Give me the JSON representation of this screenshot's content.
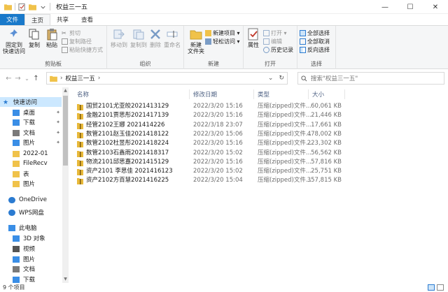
{
  "window": {
    "title": "权益三一五",
    "controls": {
      "minimize": "—",
      "maximize": "☐",
      "close": "✕"
    }
  },
  "ribbon_tabs": [
    "文件",
    "主页",
    "共享",
    "查看"
  ],
  "ribbon": {
    "clipboard": {
      "label": "剪贴板",
      "pin": "固定到\n快速访问",
      "copy": "复制",
      "paste": "粘贴",
      "cut": "剪切",
      "copy_path": "复制路径",
      "paste_shortcut": "粘贴快捷方式"
    },
    "organize": {
      "label": "组织",
      "move_to": "移动到",
      "copy_to": "复制到",
      "delete": "删除",
      "rename": "重命名"
    },
    "new": {
      "label": "新建",
      "new_folder": "新建\n文件夹",
      "new_item": "新建项目 ▾",
      "easy_access": "轻松访问 ▾"
    },
    "open": {
      "label": "打开",
      "properties": "属性",
      "open": "打开 ▾",
      "edit": "编辑",
      "history": "历史记录"
    },
    "select": {
      "label": "选择",
      "select_all": "全部选择",
      "select_none": "全部取消",
      "invert": "反向选择"
    }
  },
  "navigation": {
    "back": "←",
    "forward": "→",
    "recent": "⌄",
    "up": "↑",
    "breadcrumb": "权益三一五",
    "breadcrumb_sep": "›",
    "dropdown": "⌄",
    "refresh": "↻",
    "search_placeholder": "搜索\"权益三一五\""
  },
  "nav_pane": [
    {
      "label": "快速访问",
      "icon": "star-icon",
      "color": "#2b7bd1",
      "pinned": false,
      "selected": true
    },
    {
      "label": "桌面",
      "icon": "desktop-icon",
      "color": "#3a8ee6",
      "pinned": true,
      "selected": false
    },
    {
      "label": "下载",
      "icon": "download-icon",
      "color": "#3a8ee6",
      "pinned": true,
      "selected": false
    },
    {
      "label": "文档",
      "icon": "document-icon",
      "color": "#7a7a7a",
      "pinned": true,
      "selected": false
    },
    {
      "label": "图片",
      "icon": "pictures-icon",
      "color": "#3a8ee6",
      "pinned": true,
      "selected": false
    },
    {
      "label": "2022-01",
      "icon": "folder-icon",
      "color": "#f0c24a",
      "pinned": false,
      "selected": false
    },
    {
      "label": "FileRecv",
      "icon": "folder-icon",
      "color": "#f0c24a",
      "pinned": false,
      "selected": false
    },
    {
      "label": "表",
      "icon": "folder-icon",
      "color": "#f0c24a",
      "pinned": false,
      "selected": false
    },
    {
      "label": "图片",
      "icon": "folder-icon",
      "color": "#f0c24a",
      "pinned": false,
      "selected": false
    },
    {
      "label": "OneDrive",
      "icon": "cloud-icon",
      "color": "#2b7bd1",
      "pinned": false,
      "selected": false
    },
    {
      "label": "WPS网盘",
      "icon": "cloud-drive-icon",
      "color": "#2b7bd1",
      "pinned": false,
      "selected": false
    },
    {
      "label": "此电脑",
      "icon": "computer-icon",
      "color": "#3a8ee6",
      "pinned": false,
      "selected": false
    },
    {
      "label": "3D 对象",
      "icon": "3d-objects-icon",
      "color": "#3a8ee6",
      "pinned": false,
      "selected": false
    },
    {
      "label": "视频",
      "icon": "video-icon",
      "color": "#555555",
      "pinned": false,
      "selected": false
    },
    {
      "label": "图片",
      "icon": "pictures-icon",
      "color": "#3a8ee6",
      "pinned": false,
      "selected": false
    },
    {
      "label": "文档",
      "icon": "document-icon",
      "color": "#7a7a7a",
      "pinned": false,
      "selected": false
    },
    {
      "label": "下载",
      "icon": "download-icon",
      "color": "#3a8ee6",
      "pinned": false,
      "selected": false
    }
  ],
  "pin_glyph": "✦",
  "columns": {
    "name": "名称",
    "date": "修改日期",
    "type": "类型",
    "size": "大小"
  },
  "files": [
    {
      "name": "国贸2101尤亚皎2021413129",
      "date": "2022/3/20 15:16",
      "type": "压缩(zipped)文件...",
      "size": "60,061 KB"
    },
    {
      "name": "金融2101贾思彤2021417139",
      "date": "2022/3/20 15:16",
      "type": "压缩(zipped)文件...",
      "size": "21,446 KB"
    },
    {
      "name": "经管2102王娜 2021414226",
      "date": "2022/3/18 23:07",
      "type": "压缩(zipped)文件...",
      "size": "17,661 KB"
    },
    {
      "name": "数管2101赵玉佳2021418122",
      "date": "2022/3/20 15:06",
      "type": "压缩(zipped)文件...",
      "size": "478,002 KB"
    },
    {
      "name": "数管2102杜昱彤2021418224",
      "date": "2022/3/20 15:16",
      "type": "压缩(zipped)文件...",
      "size": "223,302 KB"
    },
    {
      "name": "数管2103石鑫雨2021418317",
      "date": "2022/3/20 15:02",
      "type": "压缩(zipped)文件...",
      "size": "56,562 KB"
    },
    {
      "name": "物流2101邱思嘉2021415129",
      "date": "2022/3/20 15:16",
      "type": "压缩(zipped)文件...",
      "size": "57,816 KB"
    },
    {
      "name": "资产2101 李思佳 2021416123",
      "date": "2022/3/20 15:02",
      "type": "压缩(zipped)文件...",
      "size": "25,751 KB"
    },
    {
      "name": "资产2102方百慧2021416225",
      "date": "2022/3/20 15:04",
      "type": "压缩(zipped)文件...",
      "size": "357,815 KB"
    }
  ],
  "status": {
    "item_count": "9 个项目"
  }
}
